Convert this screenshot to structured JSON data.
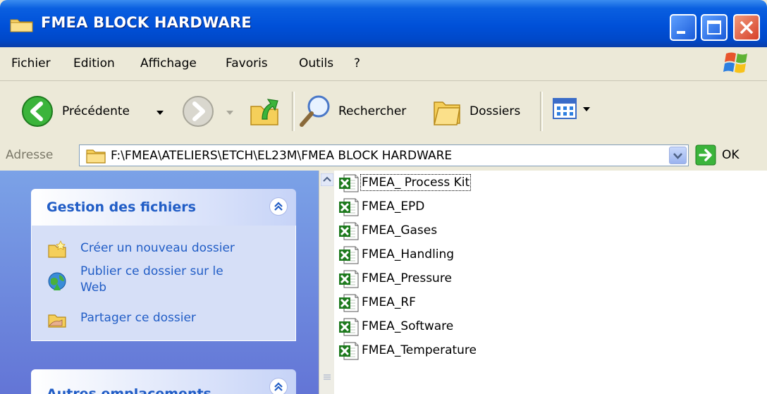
{
  "window": {
    "title": "FMEA BLOCK HARDWARE"
  },
  "menubar": {
    "items": [
      "Fichier",
      "Edition",
      "Affichage",
      "Favoris",
      "Outils",
      "?"
    ]
  },
  "toolbar": {
    "back_label": "Précédente",
    "search_label": "Rechercher",
    "folders_label": "Dossiers"
  },
  "address": {
    "label": "Adresse",
    "path": "F:\\FMEA\\ATELIERS\\ETCH\\EL23M\\FMEA BLOCK HARDWARE",
    "go_label": "OK"
  },
  "taskpane": {
    "file_tasks": {
      "title": "Gestion des fichiers",
      "items": [
        {
          "label": "Créer un nouveau dossier",
          "icon": "new-folder-icon"
        },
        {
          "label_line1": "Publier ce dossier sur le",
          "label_line2": "Web",
          "icon": "publish-web-icon"
        },
        {
          "label": "Partager ce dossier",
          "icon": "share-folder-icon"
        }
      ]
    },
    "other_places": {
      "title": "Autres emplacements"
    }
  },
  "files": [
    {
      "name": "FMEA_ Process Kit",
      "icon": "excel-file-icon",
      "selected": true
    },
    {
      "name": "FMEA_EPD",
      "icon": "excel-file-icon"
    },
    {
      "name": "FMEA_Gases",
      "icon": "excel-file-icon"
    },
    {
      "name": "FMEA_Handling",
      "icon": "excel-file-icon"
    },
    {
      "name": "FMEA_Pressure",
      "icon": "excel-file-icon"
    },
    {
      "name": "FMEA_RF",
      "icon": "excel-file-icon"
    },
    {
      "name": "FMEA_Software",
      "icon": "excel-file-icon"
    },
    {
      "name": "FMEA_Temperature",
      "icon": "excel-file-icon"
    }
  ],
  "colors": {
    "titlebar": "#0050d8",
    "taskpane": "#7ba2e7",
    "link": "#215dc6",
    "excel_green": "#1e7a1e"
  }
}
